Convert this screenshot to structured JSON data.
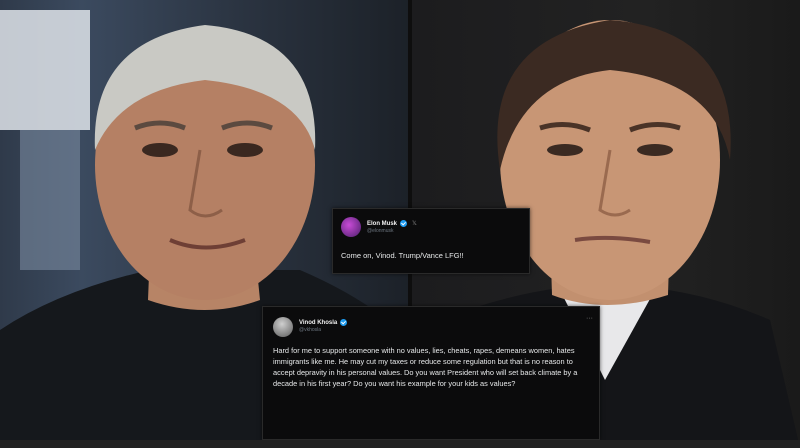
{
  "left_person": "left-portrait",
  "right_person": "right-portrait",
  "tweet_elon": {
    "name": "Elon Musk",
    "handle": "@elonmusk",
    "text": "Come on, Vinod. Trump/Vance LFG!!"
  },
  "tweet_vinod": {
    "name": "Vinod Khosla",
    "handle": "@vkhosla",
    "text": "Hard for me to  support someone with no values, lies, cheats, rapes, demeans women, hates immigrants like me. He may cut my taxes or reduce some regulation but that is no reason to accept depravity in his personal values. Do you want President who will set back climate by a decade in his first year? Do you want his example for your kids as values?"
  },
  "colors": {
    "tweet_bg": "#0b0b0c",
    "verified": "#1d9bf0",
    "text": "#e7e9ea"
  }
}
